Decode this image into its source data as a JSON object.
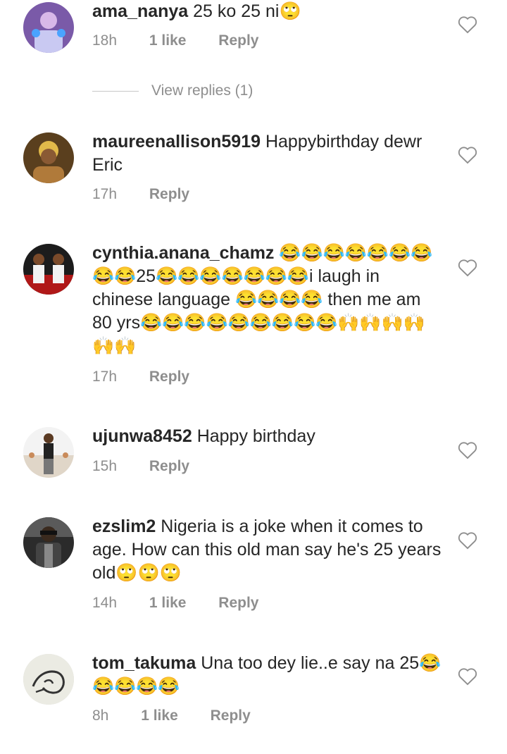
{
  "comments": [
    {
      "username": "ama_nanya",
      "text": "25 ko 25 ni🙄",
      "time": "18h",
      "likes": "1 like",
      "reply": "Reply",
      "view_replies": "View replies (1)"
    },
    {
      "username": "maureenallison5919",
      "text": "Happybirthday dewr Eric",
      "time": "17h",
      "likes": "",
      "reply": "Reply"
    },
    {
      "username": "cynthia.anana_chamz",
      "text": "😂😂😂😂😂😂😂😂😂25😂😂😂😂😂😂😂i laugh in chinese language 😂😂😂😂 then me am 80 yrs😂😂😂😂😂😂😂😂😂🙌🙌🙌🙌🙌🙌",
      "time": "17h",
      "likes": "",
      "reply": "Reply"
    },
    {
      "username": "ujunwa8452",
      "text": "Happy birthday",
      "time": "15h",
      "likes": "",
      "reply": "Reply"
    },
    {
      "username": "ezslim2",
      "text": "Nigeria is a joke when it comes to age. How can this old man say he's 25 years old🙄🙄🙄",
      "time": "14h",
      "likes": "1 like",
      "reply": "Reply"
    },
    {
      "username": "tom_takuma",
      "text": "Una too dey lie..e say na 25😂😂😂😂😂",
      "time": "8h",
      "likes": "1 like",
      "reply": "Reply"
    }
  ],
  "colors": {
    "text": "#262626",
    "meta": "#8e8e8e",
    "heart_stroke": "#8e8e8e",
    "divider": "#c7c7c7"
  },
  "icons": {
    "like": "heart-outline-icon"
  }
}
